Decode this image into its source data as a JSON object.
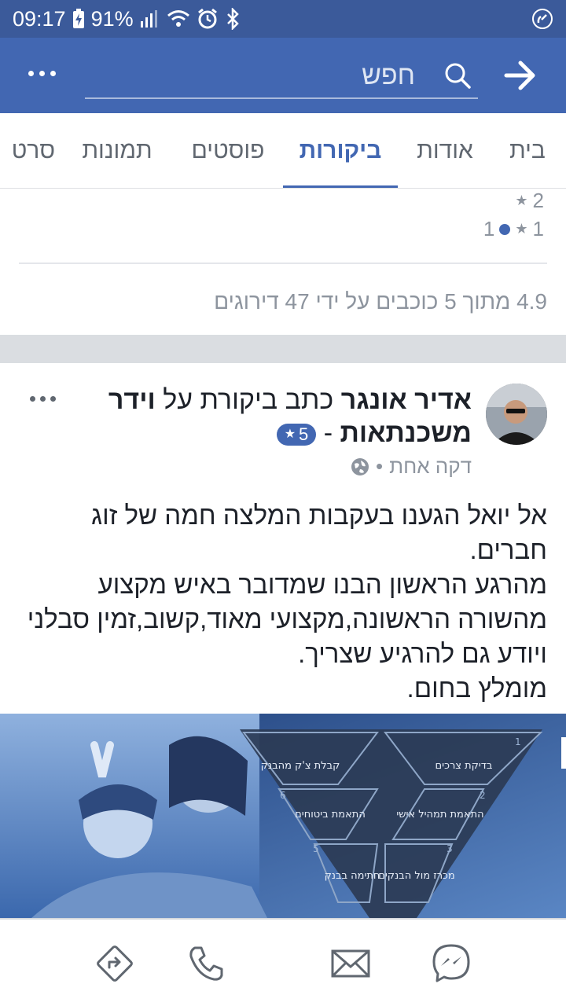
{
  "status": {
    "time": "09:17",
    "battery": "91%"
  },
  "header": {
    "search_placeholder": "חפש",
    "icons": [
      "more-icon",
      "search-icon",
      "back-arrow-icon"
    ]
  },
  "tabs": [
    {
      "label": "בית",
      "active": false
    },
    {
      "label": "אודות",
      "active": false
    },
    {
      "label": "ביקורות",
      "active": true
    },
    {
      "label": "פוסטים",
      "active": false
    },
    {
      "label": "תמונות",
      "active": false
    },
    {
      "label": "סרט",
      "active": false
    }
  ],
  "ratings": {
    "rows": [
      {
        "stars": "2",
        "count": ""
      },
      {
        "stars": "1",
        "count": "1"
      }
    ],
    "summary": "4.9 מתוך 5 כוכבים על ידי 47 דירוגים"
  },
  "post": {
    "author": "אדיר אונגר",
    "action": "כתב ביקורת על",
    "page": "וידר משכנתאות",
    "dash": "-",
    "rating": "5",
    "time": "דקה אחת",
    "body_lines": [
      "אל יואל הגענו בעקבות המלצה חמה של זוג",
      "חברים.",
      "מהרגע הראשון הבנו שמדובר באיש מקצוע",
      "מהשורה הראשונה,מקצועי מאוד,קשוב,זמין סבלני",
      "ויודע גם להרגיע שצריך.",
      "מומלץ בחום."
    ],
    "image_labels": [
      {
        "num": "1",
        "text": "בדיקת צרכים"
      },
      {
        "num": "2",
        "text": "התאמת תמהיל אישי"
      },
      {
        "num": "3",
        "text": "מכרז מול הבנקים"
      },
      {
        "num": "5",
        "text": "חתימה בבנק"
      },
      {
        "num": "6",
        "text": "התאמת ביטוחים"
      },
      {
        "num": "",
        "text": "קבלת צ'ק מהבנק"
      }
    ]
  },
  "bottom": {
    "icons": [
      "directions-icon",
      "phone-icon",
      "mail-icon",
      "messenger-icon"
    ]
  },
  "colors": {
    "brand": "#4267b2",
    "statusbar": "#3b5a9a"
  }
}
